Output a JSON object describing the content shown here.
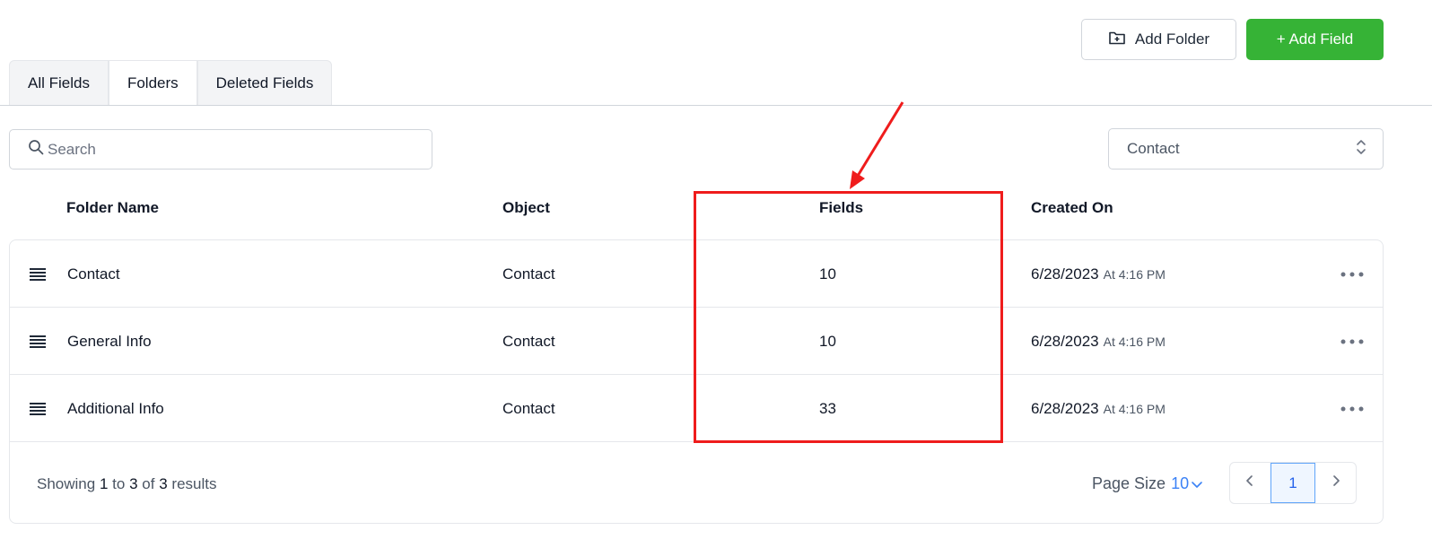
{
  "header": {
    "add_folder_label": "Add Folder",
    "add_field_label": "+ Add Field"
  },
  "tabs": [
    {
      "label": "All Fields",
      "active": false
    },
    {
      "label": "Folders",
      "active": true
    },
    {
      "label": "Deleted Fields",
      "active": false
    }
  ],
  "search": {
    "placeholder": "Search",
    "value": ""
  },
  "object_filter": {
    "selected": "Contact"
  },
  "table": {
    "columns": {
      "folder_name": "Folder Name",
      "object": "Object",
      "fields": "Fields",
      "created_on": "Created On"
    },
    "rows": [
      {
        "folder_name": "Contact",
        "object": "Contact",
        "fields": "10",
        "created_date": "6/28/2023",
        "created_time": "At 4:16 PM"
      },
      {
        "folder_name": "General Info",
        "object": "Contact",
        "fields": "10",
        "created_date": "6/28/2023",
        "created_time": "At 4:16 PM"
      },
      {
        "folder_name": "Additional Info",
        "object": "Contact",
        "fields": "33",
        "created_date": "6/28/2023",
        "created_time": "At 4:16 PM"
      }
    ]
  },
  "footer": {
    "showing_prefix": "Showing",
    "from": "1",
    "to_word": "to",
    "to": "3",
    "of_word": "of",
    "total": "3",
    "results_word": "results",
    "page_size_label": "Page Size",
    "page_size_value": "10",
    "current_page": "1"
  },
  "colors": {
    "primary_green": "#36b336",
    "accent_blue": "#3b82f6",
    "annotation_red": "#ef1c1c"
  }
}
